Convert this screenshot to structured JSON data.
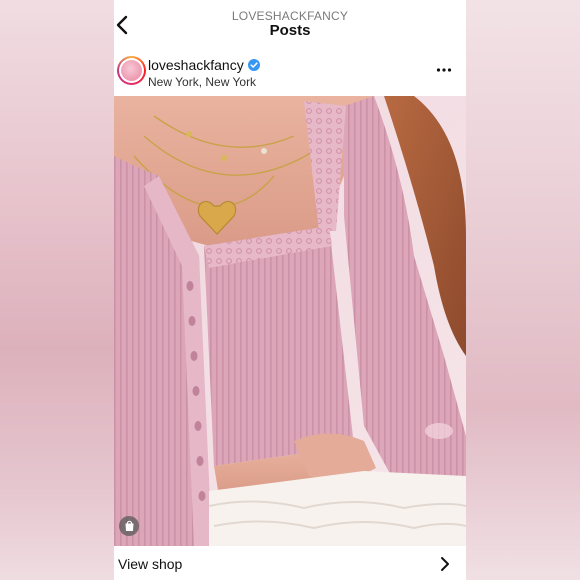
{
  "header": {
    "account": "LOVESHACKFANCY",
    "section": "Posts"
  },
  "post": {
    "username": "loveshackfancy",
    "verified": true,
    "location": "New York, New York",
    "more_icon": "more-horizontal-icon"
  },
  "photo": {
    "shop_icon": "shopping-bag-icon"
  },
  "footer": {
    "view_shop_label": "View shop",
    "chevron_icon": "chevron-right-icon"
  },
  "colors": {
    "verified_blue": "#3897f0",
    "sweater_pink": "#dca6b8",
    "background_pink": "#ead2d8"
  }
}
